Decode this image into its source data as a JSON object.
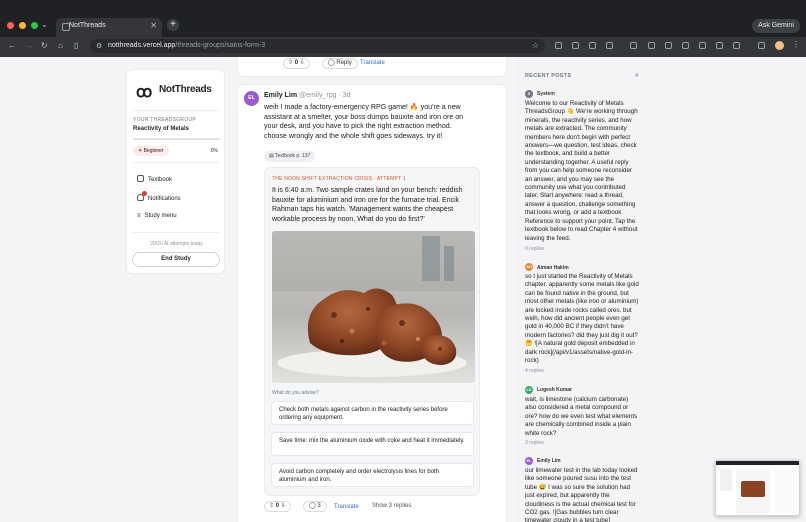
{
  "browser": {
    "tab_title": "NotThreads",
    "url_host": "notthreads.vercel.app",
    "url_path": "/threads-groups/sains-form-3",
    "ask_gemini": "Ask Gemini"
  },
  "sidebar": {
    "logo_text": "NotThreads",
    "group_label": "YOUR THREADSGROUP",
    "group_name": "Reactivity of Metals",
    "progress": 0,
    "level": "Beginner",
    "level_pct": "0%",
    "nav": [
      {
        "label": "Textbook",
        "icon": "book-icon"
      },
      {
        "label": "Notifications",
        "icon": "bell-icon",
        "badge": ""
      },
      {
        "label": "Study menu",
        "icon": "menu-icon"
      }
    ],
    "attempts": "20/20 AI attempts today",
    "end_study": "End Study"
  },
  "prev_post_actions": {
    "votes": "0",
    "reply": "Reply",
    "translate": "Translate"
  },
  "post": {
    "avatar_initials": "EL",
    "author": "Emily Lim",
    "handle": "@emily_rpg",
    "time": "3d",
    "body": "weih I made a factory-emergency RPG game! 🔥 you're a new assistant at a smelter, your boss dumps bauxite and iron ore on your desk, and you have to pick the right extraction method. choose wrongly and the whole shift goes sideways. try it!",
    "textbook_ref": "Textbook p. 137",
    "scenario": {
      "label": "THE NOON SHIFT EXTRACTION CRISIS · ATTEMPT 1",
      "text": "It is 6:40 a.m. Two sample crates land on your bench: reddish bauxite for aluminium and iron ore for the furnace trial. Encik Rahman taps his watch. 'Management wants the cheapest workable process by noon. What do you do first?'",
      "advise_label": "What do you advise?",
      "options": [
        "Check both metals against carbon in the reactivity series before ordering any equipment.",
        "Save time: mix the aluminium oxide with coke and heat it immediately.",
        "Avoid carbon completely and order electrolysis lines for both aluminium and iron."
      ]
    },
    "votes": "0",
    "reply_count": "3",
    "translate": "Translate",
    "show_replies": "Show 3 replies"
  },
  "recent": {
    "heading": "RECENT POSTS",
    "count": "4",
    "items": [
      {
        "initials": "S",
        "name": "System",
        "color": "#6e7781",
        "text": "Welcome to our Reactivity of Metals ThreadsGroup 👋 We're working through minerals, the reactivity series, and how metals are extracted. The community members here don't begin with perfect answers—we question, test ideas, check the textbook, and build a better understanding together. A useful reply from you can help someone reconsider an answer, and you may see the community use what you contributed later. Start anywhere: read a thread, answer a question, challenge something that looks wrong, or add a textbook Reference to support your point. Tap the textbook below to read Chapter 4 without leaving the feed.",
        "replies": "0 replies"
      },
      {
        "initials": "AH",
        "name": "Aiman Hakim",
        "color": "#e08a3c",
        "text": "so I just started the Reactivity of Metals chapter. apparently some metals like gold can be found native in the ground, but most other metals (like iron or aluminium) are locked inside rocks called ores. but weih, how did ancient people even get gold in 40,000 BC if they didn't have modern factories? did they just dig it out? 🤔 ![A natural gold deposit embedded in dark rock](/api/v1/assets/native-gold-in-rock)",
        "replies": "4 replies"
      },
      {
        "initials": "LK",
        "name": "Logesh Kumar",
        "color": "#3fa86b",
        "text": "wait, is limestone (calcium carbonate) also considered a metal compound or ore? how do we even test what elements are chemically combined inside a plain white rock?",
        "replies": "3 replies"
      },
      {
        "initials": "EL",
        "name": "Emily Lim",
        "color": "#9b59d0",
        "text": "our limewater test in the lab today looked like someone poured susu into the test tube 😅 I was so sure the solution had just expired, but apparently the cloudiness is the actual chemical test for CO2 gas. ![Gas bubbles turn clear limewater cloudy in a test tube]",
        "replies": ""
      }
    ]
  }
}
